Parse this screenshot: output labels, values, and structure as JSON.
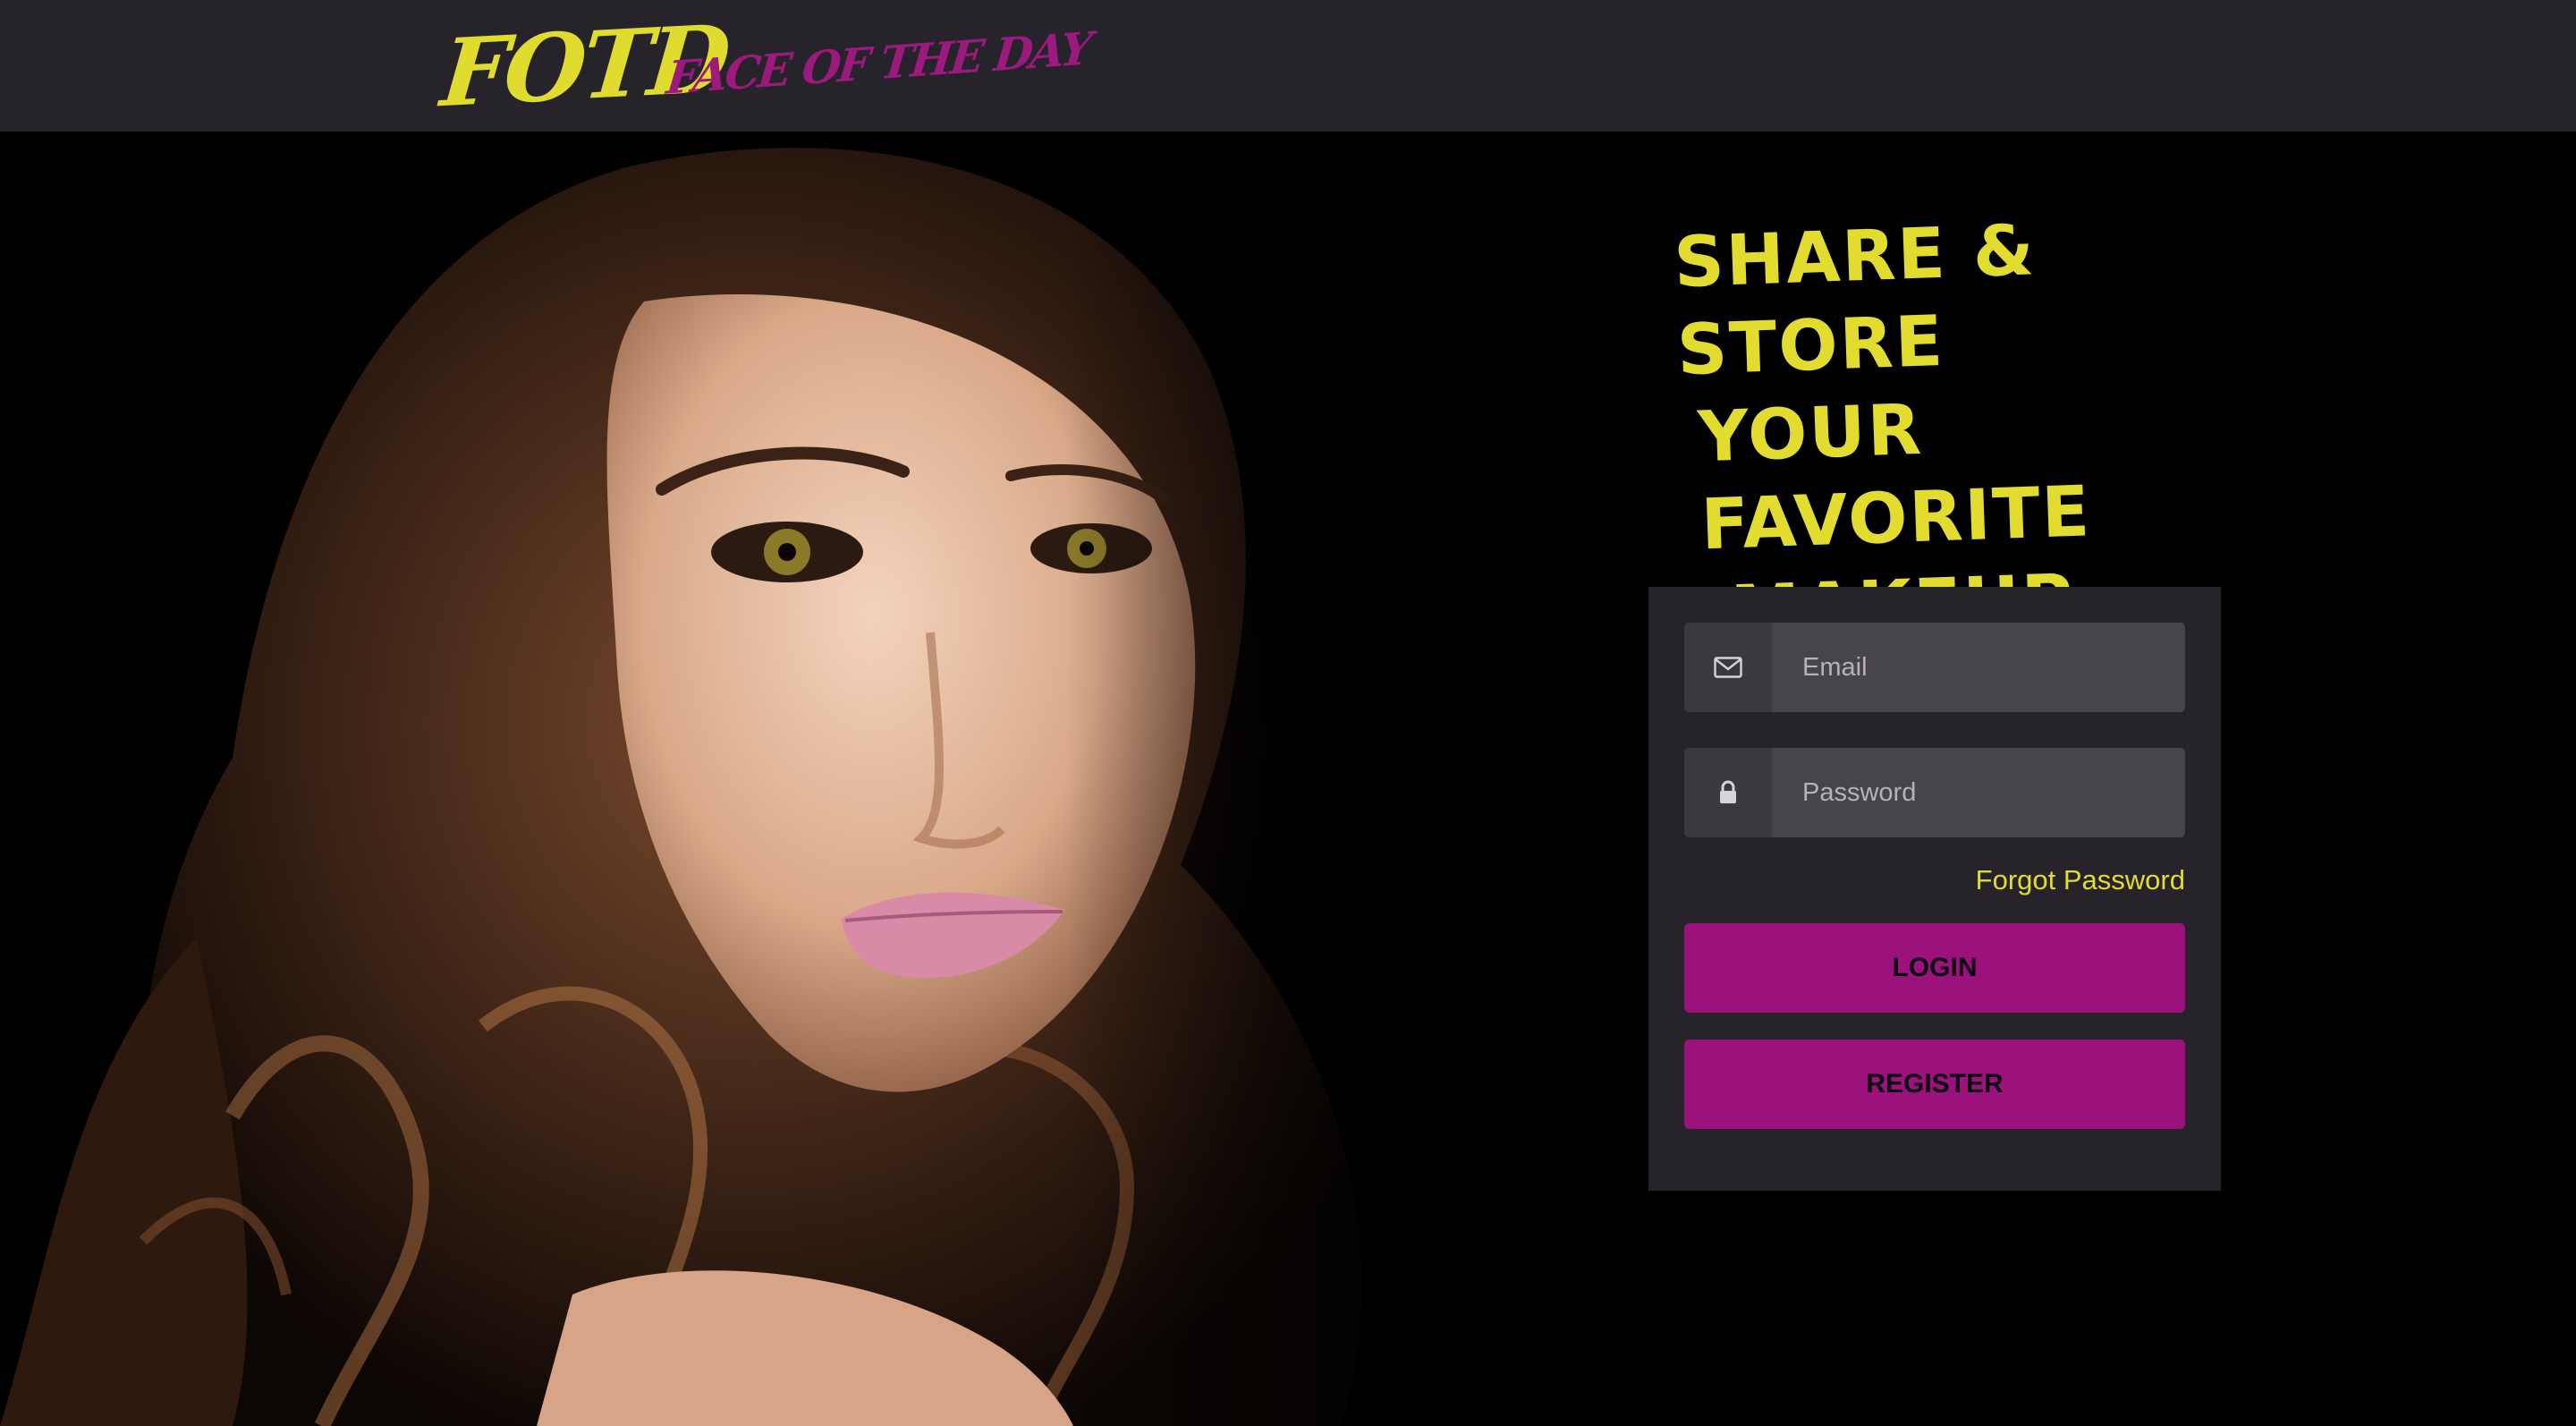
{
  "header": {
    "logo_text": "FOTD",
    "tagline": "FACE OF THE DAY"
  },
  "hero": {
    "image_alt": "Portrait of a woman with long wavy brown hair"
  },
  "headline": {
    "line1": "Share & Store",
    "line2": "Your Favorite",
    "line3": "Makeup Looks"
  },
  "login": {
    "email_placeholder": "Email",
    "email_icon": "envelope-icon",
    "password_placeholder": "Password",
    "password_icon": "lock-icon",
    "forgot_label": "Forgot Password",
    "login_label": "LOGIN",
    "register_label": "REGISTER"
  },
  "colors": {
    "header_bg": "#27232a",
    "accent_yellow": "#e2dc31",
    "accent_magenta": "#9b127c",
    "panel_bg": "#27232a",
    "input_bg": "#47444a"
  }
}
